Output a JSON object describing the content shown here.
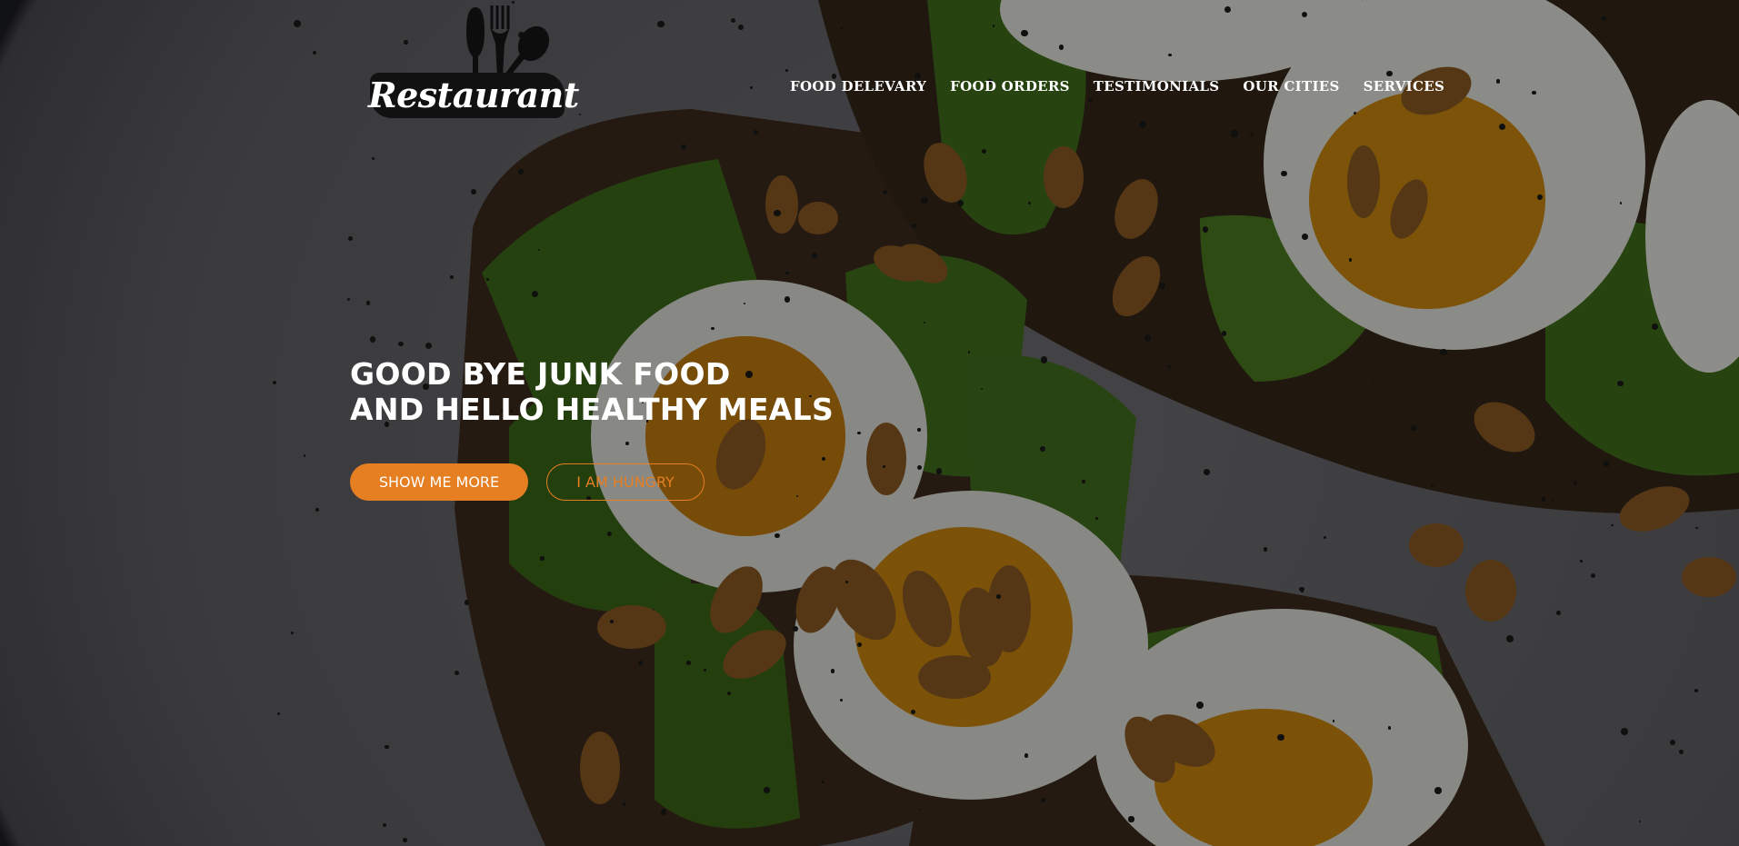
{
  "brand": {
    "logo_text": "Restaurant",
    "logo_icon": "fork-spoon-icon"
  },
  "nav": {
    "items": [
      {
        "label": "FOOD DELEVARY"
      },
      {
        "label": "FOOD ORDERS"
      },
      {
        "label": "TESTIMONIALS"
      },
      {
        "label": "OUR CITIES"
      },
      {
        "label": "SERVICES"
      }
    ]
  },
  "hero": {
    "headline_line1": "GOOD BYE JUNK FOOD",
    "headline_line2": "AND HELLO HEALTHY MEALS",
    "primary_button": "SHOW ME MORE",
    "secondary_button": "I AM HUNGRY",
    "background_image": "avocado-toast-with-eggs-photo"
  },
  "colors": {
    "accent": "#e67e22",
    "text": "#ffffff",
    "overlay": "#000000"
  }
}
